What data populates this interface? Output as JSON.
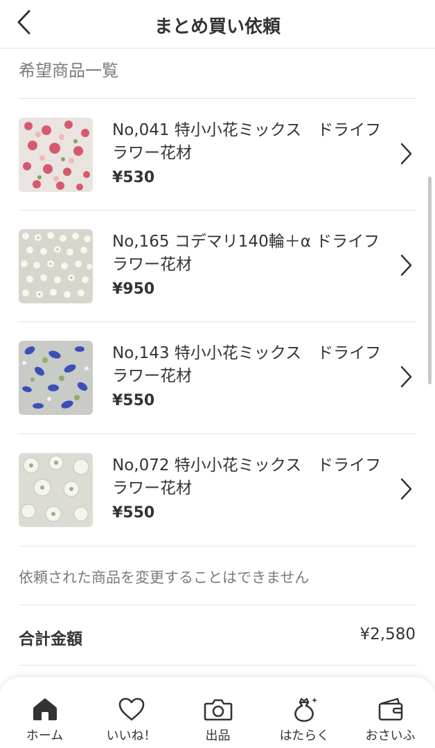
{
  "header": {
    "title": "まとめ買い依頼"
  },
  "section": {
    "title": "希望商品一覧"
  },
  "items": [
    {
      "name": "No,041 特小小花ミックス　ドライフラワー花材",
      "price": "¥530",
      "thumb": "pink-flowers"
    },
    {
      "name": "No,165 コデマリ140輪＋α ドライフラワー花材",
      "price": "¥950",
      "thumb": "white-small-flowers"
    },
    {
      "name": "No,143 特小小花ミックス　ドライフラワー花材",
      "price": "¥550",
      "thumb": "blue-flowers"
    },
    {
      "name": "No,072 特小小花ミックス　ドライフラワー花材",
      "price": "¥550",
      "thumb": "white-flowers"
    }
  ],
  "note": "依頼された商品を変更することはできません",
  "total": {
    "label": "合計金額",
    "value": "¥2,580"
  },
  "tabbar": {
    "tabs": [
      {
        "label": "ホーム",
        "icon": "home-icon",
        "active": true
      },
      {
        "label": "いいね！",
        "icon": "heart-icon"
      },
      {
        "label": "出品",
        "icon": "camera-icon"
      },
      {
        "label": "はたらく",
        "icon": "money-bag-icon"
      },
      {
        "label": "おさいふ",
        "icon": "wallet-icon"
      }
    ]
  },
  "colors": {
    "text": "#333333",
    "muted": "#7a7a7a",
    "divider": "#e2e2e2"
  }
}
